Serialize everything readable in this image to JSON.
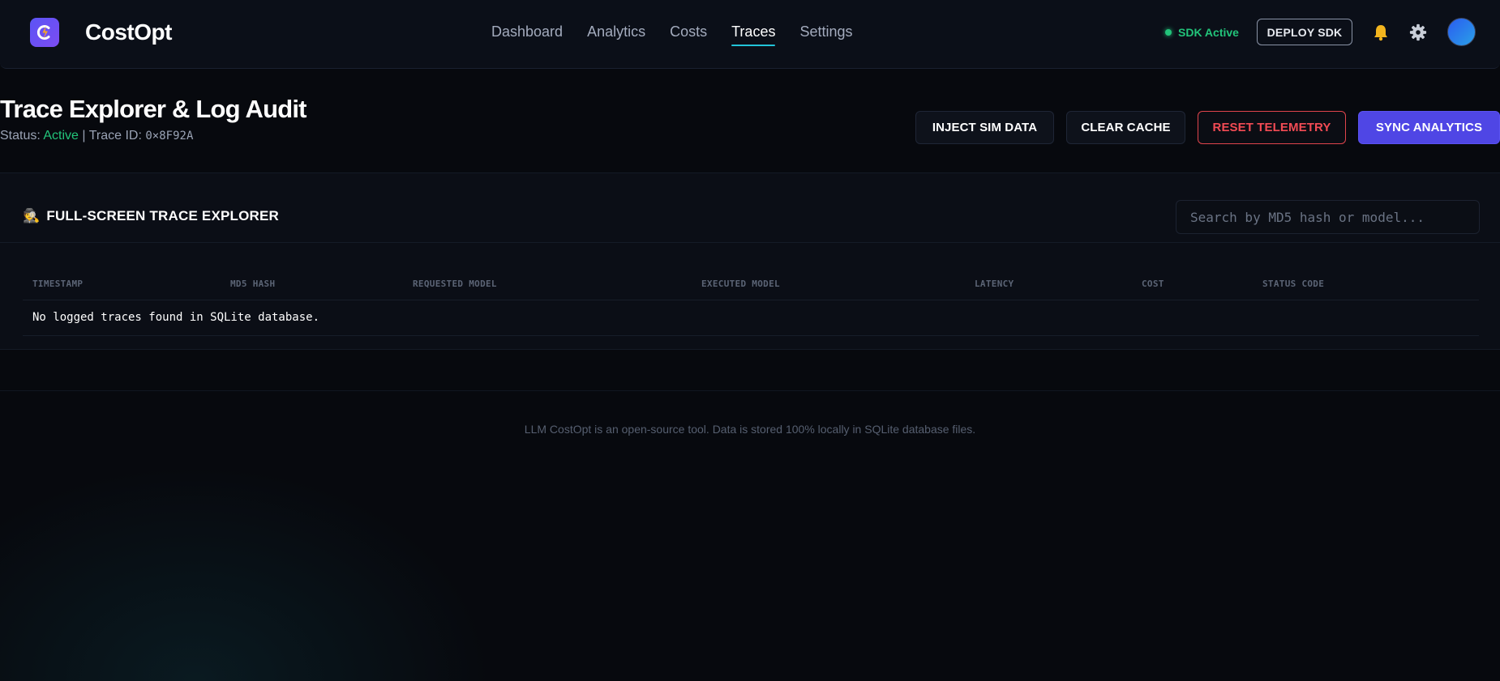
{
  "nav": {
    "brand": "CostOpt",
    "links": [
      "Dashboard",
      "Analytics",
      "Costs",
      "Traces",
      "Settings"
    ],
    "active_link": "Traces",
    "sdk_status": "SDK Active",
    "deploy_label": "DEPLOY SDK",
    "icons": [
      "costopt-logo-icon",
      "bell-icon",
      "gear-icon",
      "avatar"
    ]
  },
  "header": {
    "title": "Trace Explorer & Log Audit",
    "status_label": "Status:",
    "status_value": "Active",
    "separator": "|",
    "trace_id_label": "Trace ID:",
    "trace_id_value": "0×8F92A"
  },
  "actions": {
    "inject": "INJECT SIM DATA",
    "clear": "CLEAR CACHE",
    "reset": "RESET TELEMETRY",
    "sync": "SYNC ANALYTICS"
  },
  "panel": {
    "icon": "🕵",
    "title": "FULL-SCREEN TRACE EXPLORER",
    "search_placeholder": "Search by MD5 hash or model...",
    "search_value": "",
    "columns": [
      "TIMESTAMP",
      "MD5 HASH",
      "REQUESTED MODEL",
      "EXECUTED MODEL",
      "LATENCY",
      "COST",
      "STATUS CODE"
    ],
    "empty_message": "No logged traces found in SQLite database."
  },
  "footer": {
    "text": "LLM CostOpt is an open-source tool. Data is stored 100% locally in SQLite database files."
  },
  "colors": {
    "background": "#07090e",
    "accent": "#4f46e5",
    "active": "#22c47a",
    "danger": "#f24b54",
    "nav_underline": "#22c3d8"
  }
}
